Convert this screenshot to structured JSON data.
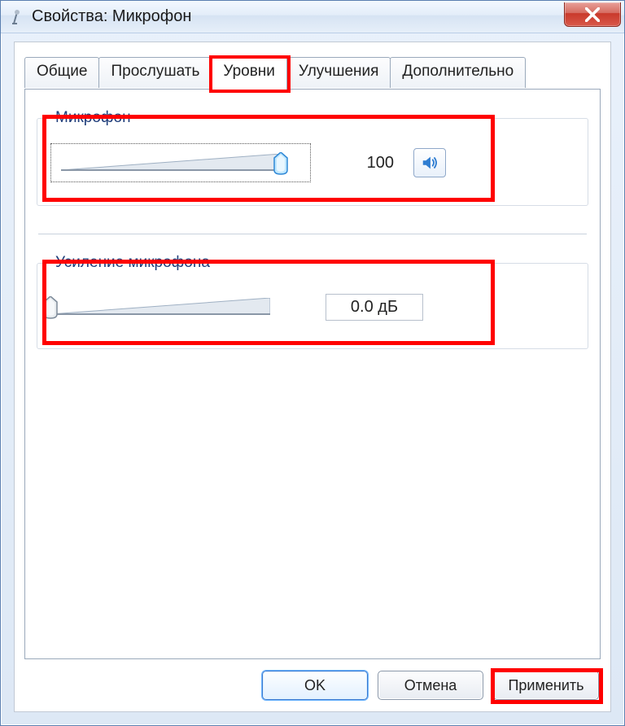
{
  "window": {
    "title": "Свойства: Микрофон"
  },
  "tabs": {
    "general": "Общие",
    "listen": "Прослушать",
    "levels": "Уровни",
    "enhance": "Улучшения",
    "advanced": "Дополнительно",
    "active": "levels"
  },
  "groups": {
    "mic": {
      "legend": "Микрофон",
      "value": "100",
      "slider_percent": 100
    },
    "boost": {
      "legend": "Усиление микрофона",
      "value": "0.0 дБ",
      "slider_percent": 0
    }
  },
  "buttons": {
    "ok": "OK",
    "cancel": "Отмена",
    "apply": "Применить"
  },
  "icons": {
    "close": "close-icon",
    "speaker": "speaker-icon",
    "mic": "microphone-icon"
  }
}
